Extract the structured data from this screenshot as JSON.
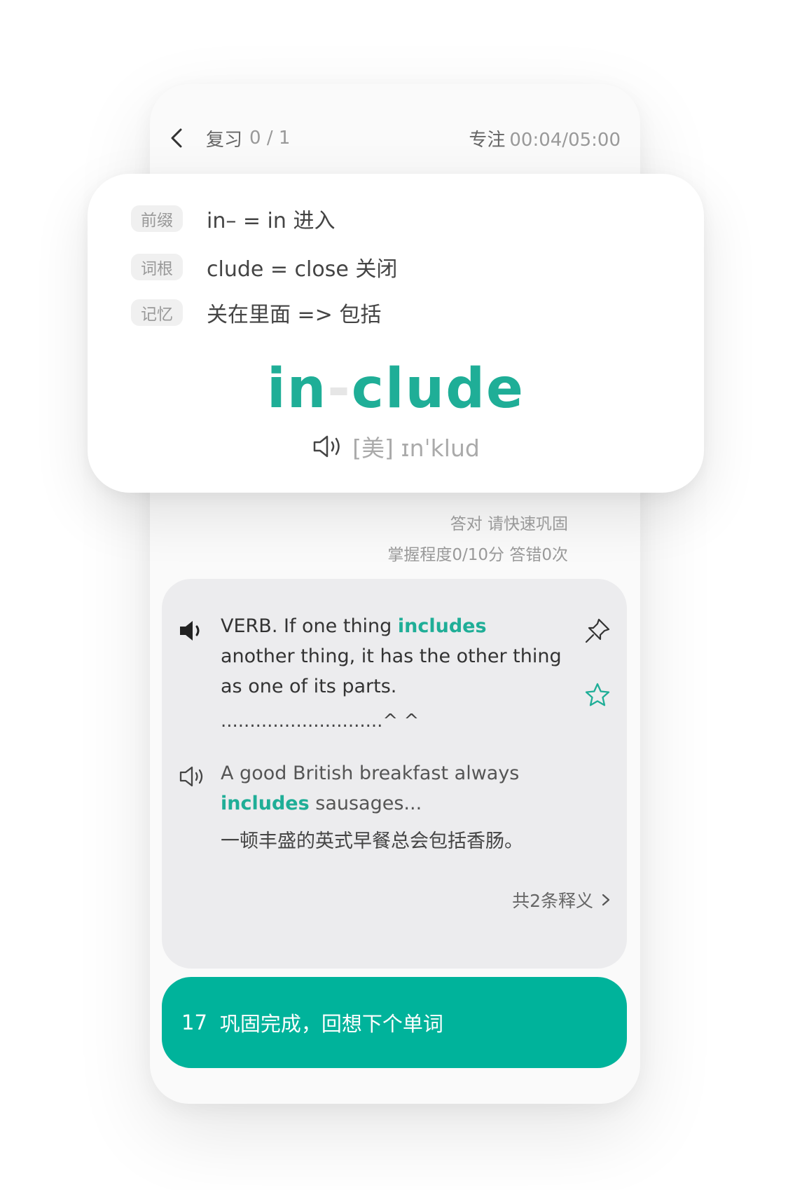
{
  "header": {
    "review_label": "复习",
    "review_count": "0 / 1",
    "focus_label": "专注",
    "focus_time": "00:04/05:00"
  },
  "roots": {
    "items": [
      {
        "tag": "前缀",
        "text": "in– = in 进入"
      },
      {
        "tag": "词根",
        "text": "clude = close 关闭"
      },
      {
        "tag": "记忆",
        "text": "关在里面 => 包括"
      }
    ]
  },
  "word": {
    "prefix": "in",
    "hyphen": "-",
    "root": "clude",
    "phonetic": "[美] ɪnˈklud"
  },
  "status": {
    "line1": "答对 请快速巩固",
    "line2": "掌握程度0/10分 答错0次"
  },
  "definition": {
    "pos_text_1": "VERB. If one thing ",
    "highlight": "includes",
    "pos_text_2": " another thing, it has the other thing as one of its parts.",
    "dots": "............................^ ^",
    "example_1": "A good British breakfast always ",
    "example_highlight": "includes",
    "example_2": " sausages...",
    "example_cn": "一顿丰盛的英式早餐总会包括香肠。",
    "more": "共2条释义"
  },
  "action": {
    "count": "17",
    "label": "巩固完成，回想下个单词"
  },
  "colors": {
    "accent": "#1fae97",
    "button": "#00b39b"
  }
}
